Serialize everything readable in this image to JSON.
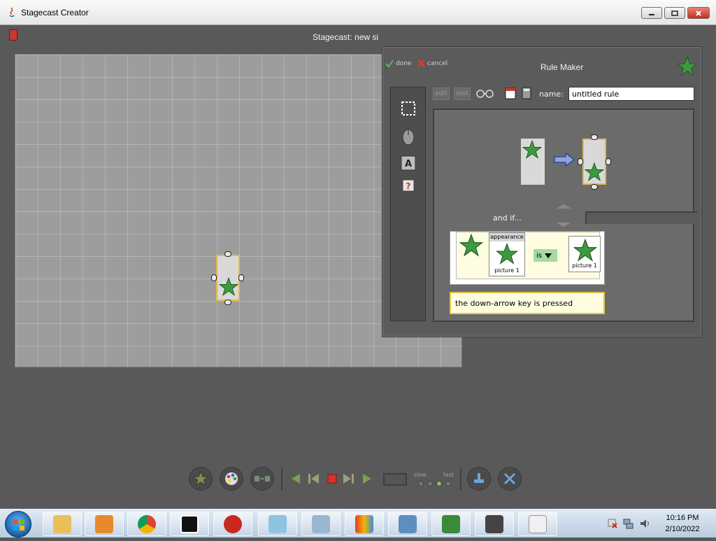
{
  "window": {
    "title": "Stagecast Creator"
  },
  "stage": {
    "title": "Stagecast: new si"
  },
  "rule_maker": {
    "title": "Rule Maker",
    "done_label": "done",
    "cancel_label": "cancel",
    "edit_label": "edit",
    "test_label": "test",
    "name_label": "name:",
    "name_value": "untitled rule",
    "and_if_label": "and if...",
    "condition": {
      "appearance_label": "appearance",
      "left_picture_label": "picture 1",
      "operator": "is",
      "right_picture_label": "picture 1"
    },
    "key_condition": "the down-arrow key is pressed"
  },
  "controls": {
    "slow_label": "slow",
    "fast_label": "fast"
  },
  "taskbar": {
    "apps": [
      "file-explorer",
      "media-player",
      "chrome",
      "7-zip",
      "app-red",
      "notepad",
      "calculator",
      "paint",
      "network",
      "spreadsheet",
      "windows",
      "java"
    ],
    "time": "10:16 PM",
    "date": "2/10/2022"
  },
  "colors": {
    "star_green": "#3f9a3f",
    "sprite_border": "#e2b94a",
    "condition_bg": "#fffde0",
    "is_dropdown_bg": "#a7d9a0"
  }
}
